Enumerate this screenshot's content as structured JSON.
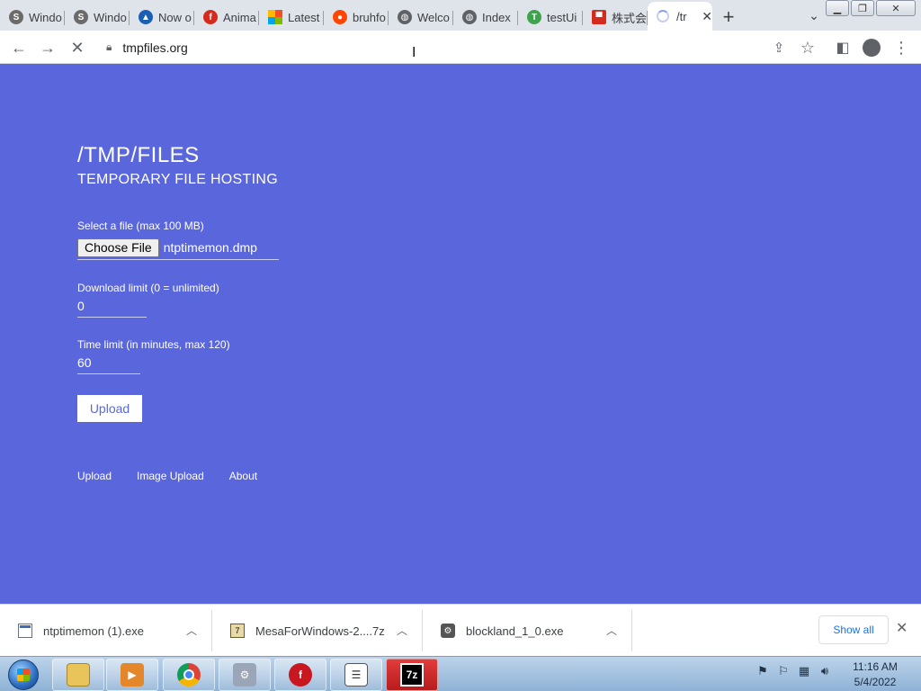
{
  "browser": {
    "tabs": [
      {
        "label": "Windo",
        "icon": "s-globe-icon",
        "color": "#6b6b6b"
      },
      {
        "label": "Windo",
        "icon": "s-globe-icon",
        "color": "#6b6b6b"
      },
      {
        "label": "Now o",
        "icon": "arch-icon",
        "color": "#1a5fb4"
      },
      {
        "label": "Anima",
        "icon": "flash-icon",
        "color": "#d52b1e"
      },
      {
        "label": "Latest",
        "icon": "windows-logo-icon",
        "color": "#f25022"
      },
      {
        "label": "bruhfo",
        "icon": "reddit-icon",
        "color": "#ff4500"
      },
      {
        "label": "Welco",
        "icon": "globe-icon",
        "color": "#5f6368"
      },
      {
        "label": "Index",
        "icon": "globe-icon",
        "color": "#5f6368"
      },
      {
        "label": "testUi",
        "icon": "t-icon",
        "color": "#3fa34d"
      },
      {
        "label": "株式会",
        "icon": "invader-icon",
        "color": "#d52b1e"
      }
    ],
    "active_tab": {
      "label": "/tr"
    },
    "url": "tmpfiles.org"
  },
  "page": {
    "title": "/TMP/FILES",
    "subtitle": "TEMPORARY FILE HOSTING",
    "file_label": "Select a file (max 100 MB)",
    "choose_file_label": "Choose File",
    "file_name": "ntptimemon.dmp",
    "download_limit_label": "Download limit (0 = unlimited)",
    "download_limit_value": "0",
    "time_limit_label": "Time limit (in minutes, max 120)",
    "time_limit_value": "60",
    "upload_button": "Upload",
    "footer_links": [
      "Upload",
      "Image Upload",
      "About"
    ]
  },
  "downloads": {
    "items": [
      {
        "name": "ntptimemon (1).exe",
        "icon": "exe-window-icon"
      },
      {
        "name": "MesaForWindows-2....7z",
        "icon": "7z-archive-icon"
      },
      {
        "name": "blockland_1_0.exe",
        "icon": "blockland-installer-icon"
      }
    ],
    "show_all": "Show all"
  },
  "taskbar": {
    "time": "11:16 AM",
    "date": "5/4/2022"
  },
  "colors": {
    "page_bg": "#5a67dc",
    "accent_link": "#1a73e8"
  }
}
